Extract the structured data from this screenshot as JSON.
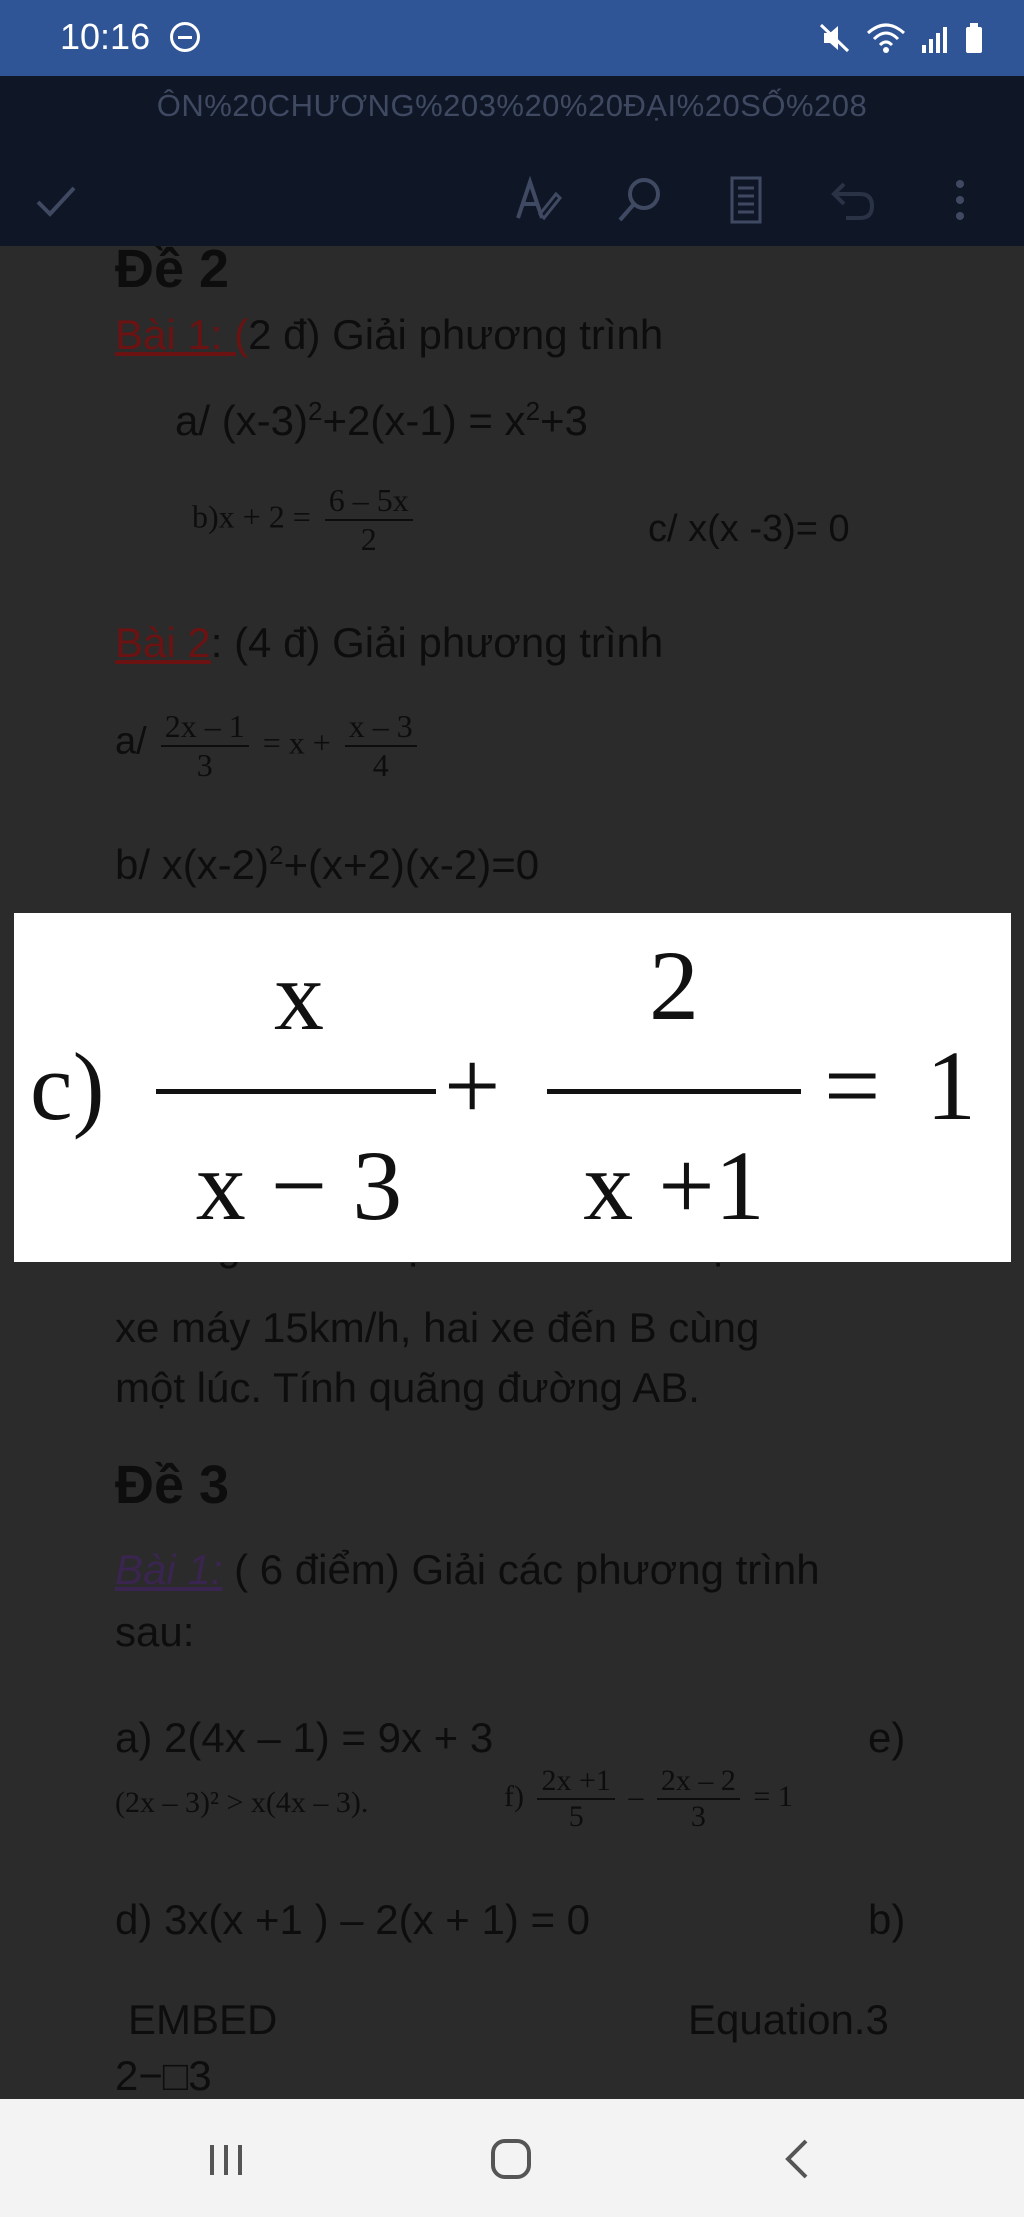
{
  "status": {
    "time": "10:16"
  },
  "app": {
    "doc_title": "ÔN%20CHƯƠNG%203%20%20ĐẠI%20SỐ%208"
  },
  "doc": {
    "de2": "Đề 2",
    "bai1_label": "Bài 1: (",
    "bai1_text": "2 đ) Giải phương trình",
    "bai1_a": "a/ (x-3)",
    "bai1_a_sup": "2",
    "bai1_a_mid": "+2(x-1) = x",
    "bai1_a_sup2": "2",
    "bai1_a_end": "+3",
    "bai1_b_prefix": "b)x + 2 =",
    "bai1_b_num": "6 – 5x",
    "bai1_b_den": "2",
    "bai1_c": "c/ x(x -3)= 0",
    "bai2_label": "Bài 2",
    "bai2_text": ": (4 đ) Giải phương trình",
    "bai2_a_prefix": "a/",
    "bai2_a_num1": "2x – 1",
    "bai2_a_den1": "3",
    "bai2_a_mid": "= x +",
    "bai2_a_num2": "x – 3",
    "bai2_a_den2": "4",
    "bai2_b": "b/ x(x-2)",
    "bai2_b_sup": "2",
    "bai2_b_end": "+(x+2)(x-2)=0",
    "partial_line": "đường  đó với vận tốc lớn hơn vận tốc",
    "line2": "xe máy 15km/h, hai xe đến B cùng",
    "line3": "một lúc. Tính quãng đường AB.",
    "de3": "Đề 3",
    "de3_bai1_label": "Bài 1:",
    "de3_bai1_text": " ( 6 điểm) Giải các phương trình",
    "de3_bai1_text2": "sau:",
    "de3_a": "a)   2(4x  –  1)  =  9x  +  3",
    "de3_e": "e)",
    "de3_ineq": "(2x – 3)² > x(4x – 3).",
    "de3_f": "f)",
    "de3_f_num1": "2x +1",
    "de3_f_den1": "5",
    "de3_f_minus": "–",
    "de3_f_num2": "2x – 2",
    "de3_f_den2": "3",
    "de3_f_end": "= 1",
    "de3_d": "d)   3x(x  +1  )  –  2(x  +  1)  =  0",
    "de3_b": "b)",
    "embed": "EMBED",
    "equation": "Equation.3",
    "last": "2−□3"
  },
  "popup": {
    "label": "c)",
    "num1": "x",
    "den1": "x − 3",
    "plus": "+",
    "num2": "2",
    "den2": "x +1",
    "equals": "=",
    "rhs": "1"
  }
}
